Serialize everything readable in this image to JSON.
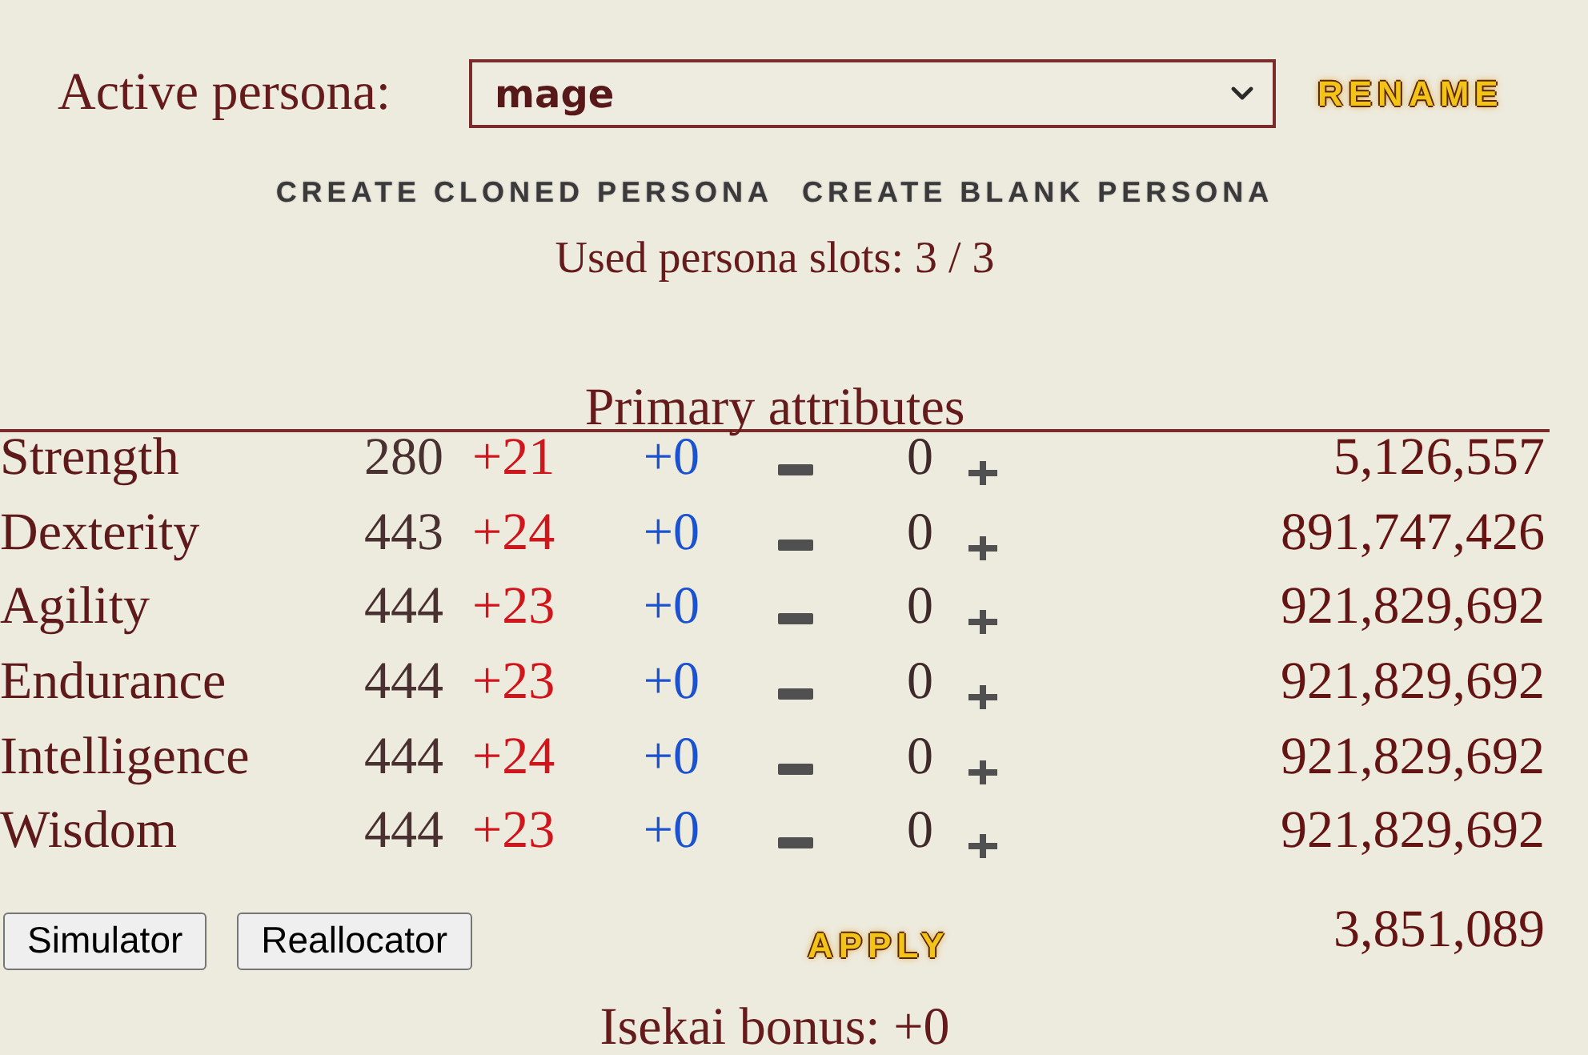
{
  "persona": {
    "label": "Active persona:",
    "value": "mage",
    "rename": "RENAME"
  },
  "create_links": [
    "CREATE CLONED PERSONA",
    "CREATE BLANK PERSONA"
  ],
  "slots": "Used persona slots: 3 / 3",
  "attributes": {
    "title": "Primary attributes",
    "rows": [
      {
        "name": "Strength",
        "column_2": "280",
        "column_3": "+21",
        "column_4": "+0",
        "column_6": "0",
        "column_8": "5,126,557"
      },
      {
        "name": "Dexterity",
        "column_2": "443",
        "column_3": "+24",
        "column_4": "+0",
        "column_6": "0",
        "column_8": "891,747,426"
      },
      {
        "name": "Agility",
        "column_2": "444",
        "column_3": "+23",
        "column_4": "+0",
        "column_6": "0",
        "column_8": "921,829,692"
      },
      {
        "name": "Endurance",
        "column_2": "444",
        "column_3": "+23",
        "column_4": "+0",
        "column_6": "0",
        "column_8": "921,829,692"
      },
      {
        "name": "Intelligence",
        "column_2": "444",
        "column_3": "+24",
        "column_4": "+0",
        "column_6": "0",
        "column_8": "921,829,692"
      },
      {
        "name": "Wisdom",
        "column_2": "444",
        "column_3": "+23",
        "column_4": "+0",
        "column_6": "0",
        "column_8": "921,829,692"
      }
    ]
  },
  "footer": {
    "buttons": [
      "Simulator",
      "Reallocator"
    ],
    "apply": "APPLY",
    "value": "3,851,089"
  },
  "isekai": "Isekai bonus: +0"
}
